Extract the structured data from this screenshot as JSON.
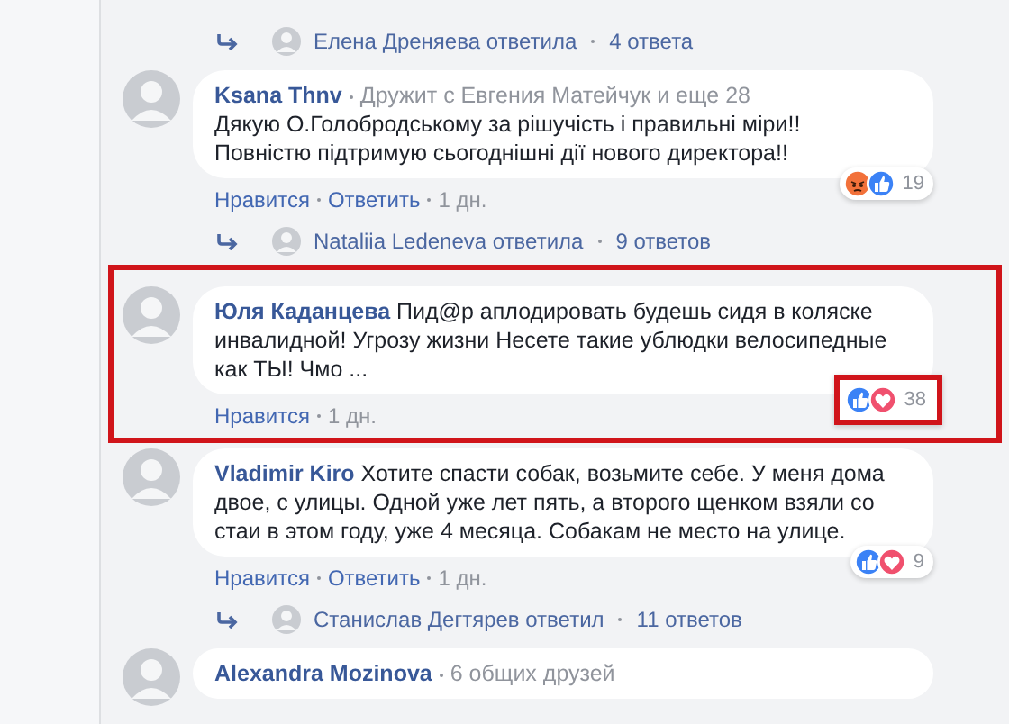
{
  "thread": [
    {
      "kind": "replies",
      "text": "Елена Дреняева ответила",
      "count": "4 ответа"
    },
    {
      "kind": "comment",
      "author": "Ksana Thnv",
      "meta": "Дружит с Евгения Матейчук и еще 28",
      "text": "Дякую О.Голобродському за рішучість і правильні міри!!\nПовністю підтримую сьогоднішні дії нового директора!!",
      "actions": [
        "Нравится",
        "Ответить"
      ],
      "time": "1 дн.",
      "reactions": [
        {
          "kind": "angry"
        },
        {
          "kind": "like"
        }
      ],
      "reaction_count": "19",
      "highlighted": false,
      "reactions_highlighted": false
    },
    {
      "kind": "replies",
      "text": "Nataliia Ledeneva ответила",
      "count": "9 ответов"
    },
    {
      "kind": "comment",
      "author": "Юля Каданцева",
      "text": "Пид@р аплодировать будешь сидя в коляске инвалидной! Угрозу жизни Несете такие ублюдки велосипедные как ТЫ! Чмо ...",
      "actions": [
        "Нравится"
      ],
      "time": "1 дн.",
      "reactions": [
        {
          "kind": "like"
        },
        {
          "kind": "love"
        }
      ],
      "reaction_count": "38",
      "highlighted": true,
      "reactions_highlighted": true
    },
    {
      "kind": "comment",
      "author": "Vladimir Kiro",
      "text": "Хотите спасти собак, возьмите себе. У меня дома двое, с улицы. Одной уже лет пять, а второго щенком взяли со стаи в этом году, уже 4 месяца. Собакам не место на улице.",
      "actions": [
        "Нравится",
        "Ответить"
      ],
      "time": "1 дн.",
      "reactions": [
        {
          "kind": "like"
        },
        {
          "kind": "love"
        }
      ],
      "reaction_count": "9",
      "highlighted": false,
      "reactions_highlighted": false
    },
    {
      "kind": "replies",
      "text": "Станислав Дегтярев ответил",
      "count": "11 ответов"
    },
    {
      "kind": "comment",
      "author": "Alexandra Mozinova",
      "meta": "6 общих друзей",
      "highlighted": false
    }
  ]
}
